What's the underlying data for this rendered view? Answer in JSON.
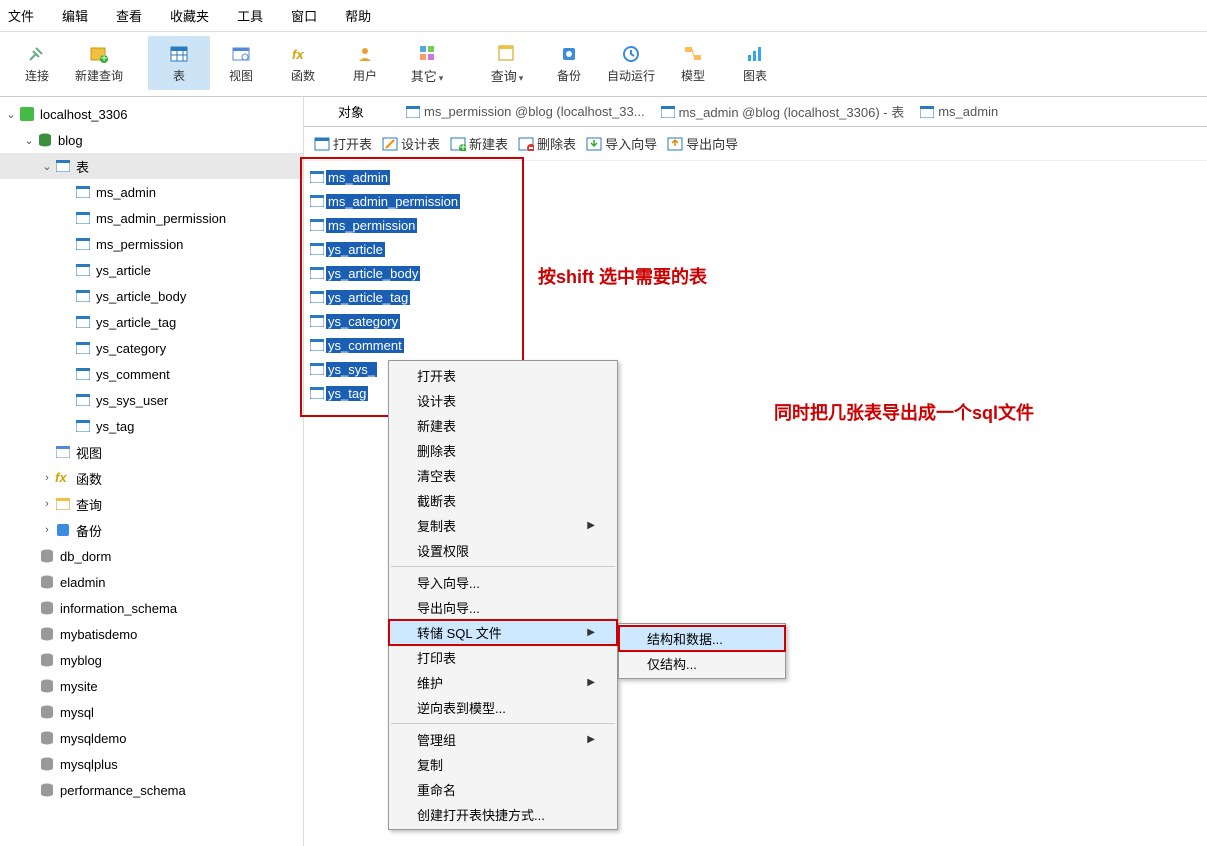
{
  "menubar": [
    "文件",
    "编辑",
    "查看",
    "收藏夹",
    "工具",
    "窗口",
    "帮助"
  ],
  "toolbar": [
    {
      "label": "连接",
      "icon": "plug"
    },
    {
      "label": "新建查询",
      "icon": "newquery"
    },
    {
      "label": "表",
      "icon": "table",
      "active": true
    },
    {
      "label": "视图",
      "icon": "view"
    },
    {
      "label": "函数",
      "icon": "fx"
    },
    {
      "label": "用户",
      "icon": "user"
    },
    {
      "label": "其它",
      "icon": "other",
      "dropdown": true
    },
    {
      "label": "查询",
      "icon": "query",
      "dropdown": true
    },
    {
      "label": "备份",
      "icon": "backup"
    },
    {
      "label": "自动运行",
      "icon": "auto"
    },
    {
      "label": "模型",
      "icon": "model"
    },
    {
      "label": "图表",
      "icon": "chart"
    }
  ],
  "tree": {
    "conn": "localhost_3306",
    "db": "blog",
    "tables_node": "表",
    "tables": [
      "ms_admin",
      "ms_admin_permission",
      "ms_permission",
      "ys_article",
      "ys_article_body",
      "ys_article_tag",
      "ys_category",
      "ys_comment",
      "ys_sys_user",
      "ys_tag"
    ],
    "views": "视图",
    "funcs": "函数",
    "queries": "查询",
    "backups": "备份",
    "other_dbs": [
      "db_dorm",
      "eladmin",
      "information_schema",
      "mybatisdemo",
      "myblog",
      "mysite",
      "mysql",
      "mysqldemo",
      "mysqlplus",
      "performance_schema"
    ]
  },
  "tabs": {
    "objects": "对象",
    "t1": "ms_permission @blog (localhost_33...",
    "t2": "ms_admin @blog (localhost_3306) - 表",
    "t3": "ms_admin"
  },
  "actionbar": [
    "打开表",
    "设计表",
    "新建表",
    "删除表",
    "导入向导",
    "导出向导"
  ],
  "selected_tables": [
    "ms_admin",
    "ms_admin_permission",
    "ms_permission",
    "ys_article",
    "ys_article_body",
    "ys_article_tag",
    "ys_category",
    "ys_comment",
    "ys_sys_",
    "ys_tag"
  ],
  "annot1": "按shift 选中需要的表",
  "annot2": "同时把几张表导出成一个sql文件",
  "context_menu": [
    "打开表",
    "设计表",
    "新建表",
    "删除表",
    "清空表",
    "截断表",
    "复制表",
    "设置权限",
    "导入向导...",
    "导出向导...",
    "转储 SQL 文件",
    "打印表",
    "维护",
    "逆向表到模型...",
    "管理组",
    "复制",
    "重命名",
    "创建打开表快捷方式..."
  ],
  "submenu": [
    "结构和数据...",
    "仅结构..."
  ]
}
